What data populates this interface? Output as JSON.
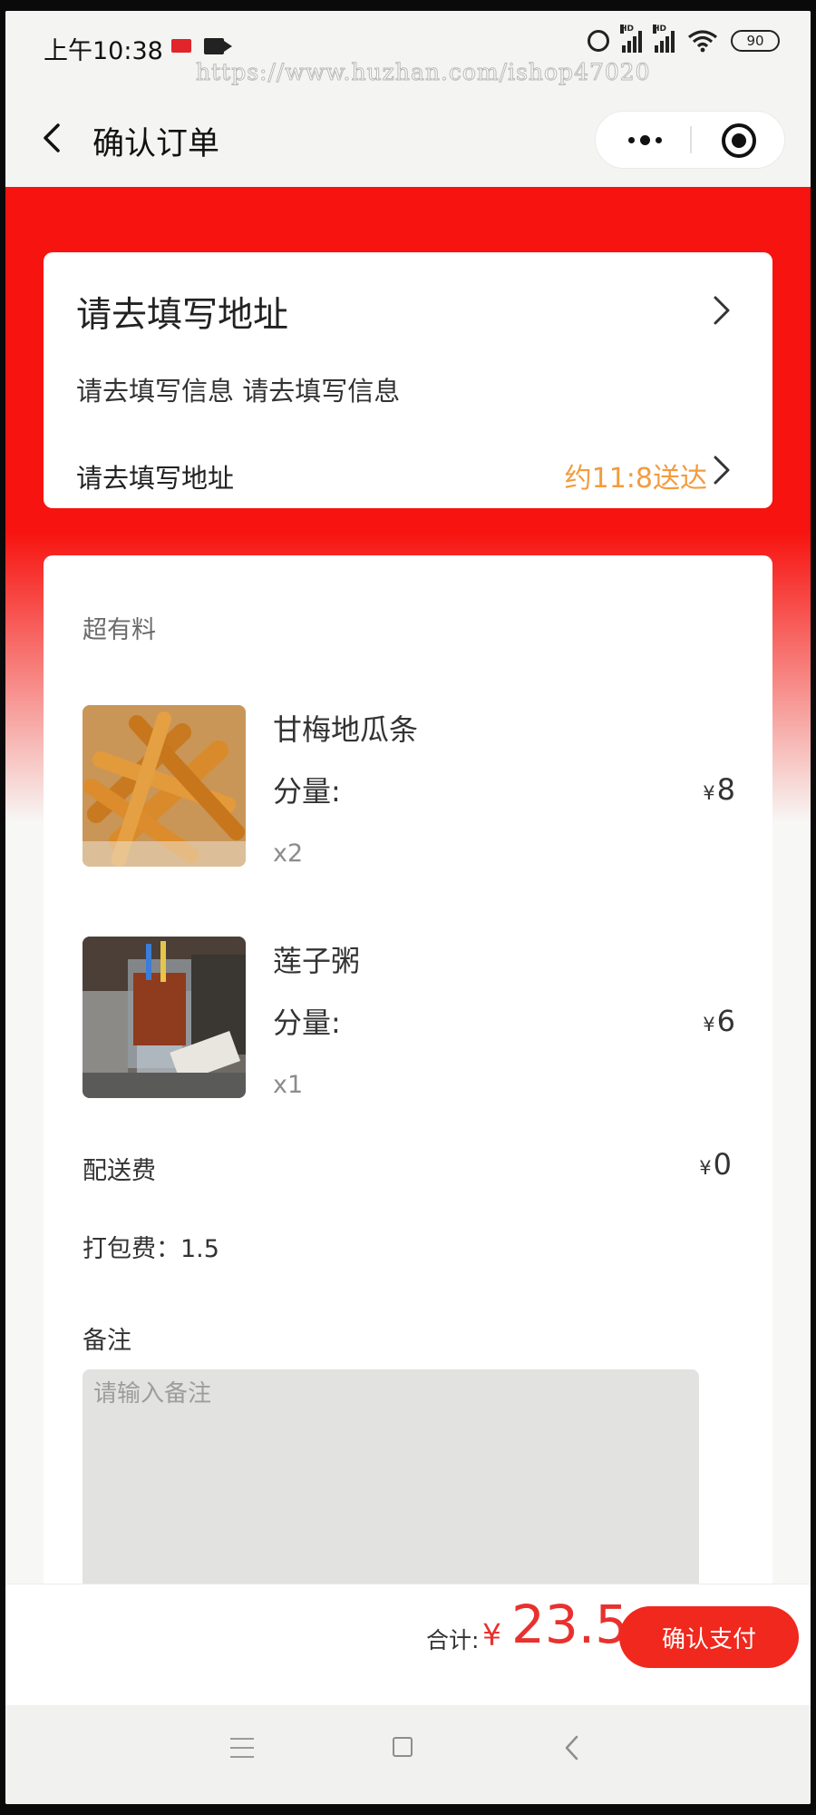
{
  "status_bar": {
    "time": "上午10:38",
    "battery": "90",
    "watermark": "https://www.huzhan.com/ishop47020",
    "icons": [
      "red-notification-icon",
      "video-camera-icon",
      "alarm-icon",
      "hd-signal-icon",
      "hd-signal-icon",
      "wifi-icon",
      "battery-icon"
    ]
  },
  "nav": {
    "title": "确认订单",
    "icons": [
      "back-arrow-icon",
      "more-dots-icon",
      "target-icon"
    ]
  },
  "address": {
    "title": "请去填写地址",
    "subtitle": "请去填写信息 请去填写信息",
    "footer_label": "请去填写地址",
    "eta": "约11:8送达"
  },
  "order": {
    "shop_name": "超有料",
    "items": [
      {
        "name": "甘梅地瓜条",
        "portion_label": "分量:",
        "qty": "x2",
        "currency": "¥",
        "price": "8",
        "image": "fried-sweet-potato-strips"
      },
      {
        "name": "莲子粥",
        "portion_label": "分量:",
        "qty": "x1",
        "currency": "¥",
        "price": "6",
        "image": "iced-drink-cup"
      }
    ],
    "delivery_fee_label": "配送费",
    "delivery_fee_currency": "¥",
    "delivery_fee": "0",
    "packing_fee": "打包费：1.5",
    "remark_label": "备注",
    "remark_placeholder": "请输入备注"
  },
  "footer": {
    "total_label": "合计:",
    "currency": "¥",
    "total": "23.5",
    "pay_button": "确认支付"
  },
  "system_nav": {
    "icons": [
      "menu-icon",
      "home-square-icon",
      "back-icon"
    ]
  },
  "colors": {
    "accent_red": "#f7130f",
    "price_red": "#e8312e",
    "eta_orange": "#f39b3f"
  }
}
